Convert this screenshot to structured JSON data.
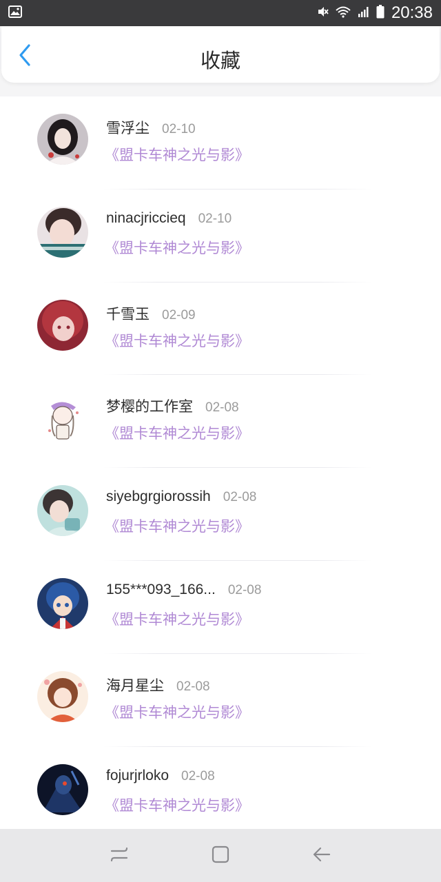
{
  "status_bar": {
    "time": "20:38",
    "icons": [
      "image-icon",
      "mute-icon",
      "wifi-icon",
      "signal-icon",
      "battery-icon"
    ]
  },
  "header": {
    "title": "收藏",
    "back_icon": "chevron-left-icon"
  },
  "colors": {
    "accent": "#2f9bf0",
    "book_link": "#b089d4",
    "date": "#9b9b9b"
  },
  "favorites": [
    {
      "name": "雪浮尘",
      "date": "02-10",
      "book": "《盟卡车神之光与影》"
    },
    {
      "name": "ninacjriccieq",
      "date": "02-10",
      "book": "《盟卡车神之光与影》"
    },
    {
      "name": "千雪玉",
      "date": "02-09",
      "book": "《盟卡车神之光与影》"
    },
    {
      "name": "梦樱的工作室",
      "date": "02-08",
      "book": "《盟卡车神之光与影》"
    },
    {
      "name": "siyebgrgiorossih",
      "date": "02-08",
      "book": "《盟卡车神之光与影》"
    },
    {
      "name": "155***093_166...",
      "date": "02-08",
      "book": "《盟卡车神之光与影》"
    },
    {
      "name": "海月星尘",
      "date": "02-08",
      "book": "《盟卡车神之光与影》"
    },
    {
      "name": "fojurjrloko",
      "date": "02-08",
      "book": "《盟卡车神之光与影》"
    }
  ],
  "nav_bar": {
    "buttons": [
      "recent-apps-icon",
      "home-icon",
      "back-icon"
    ]
  }
}
